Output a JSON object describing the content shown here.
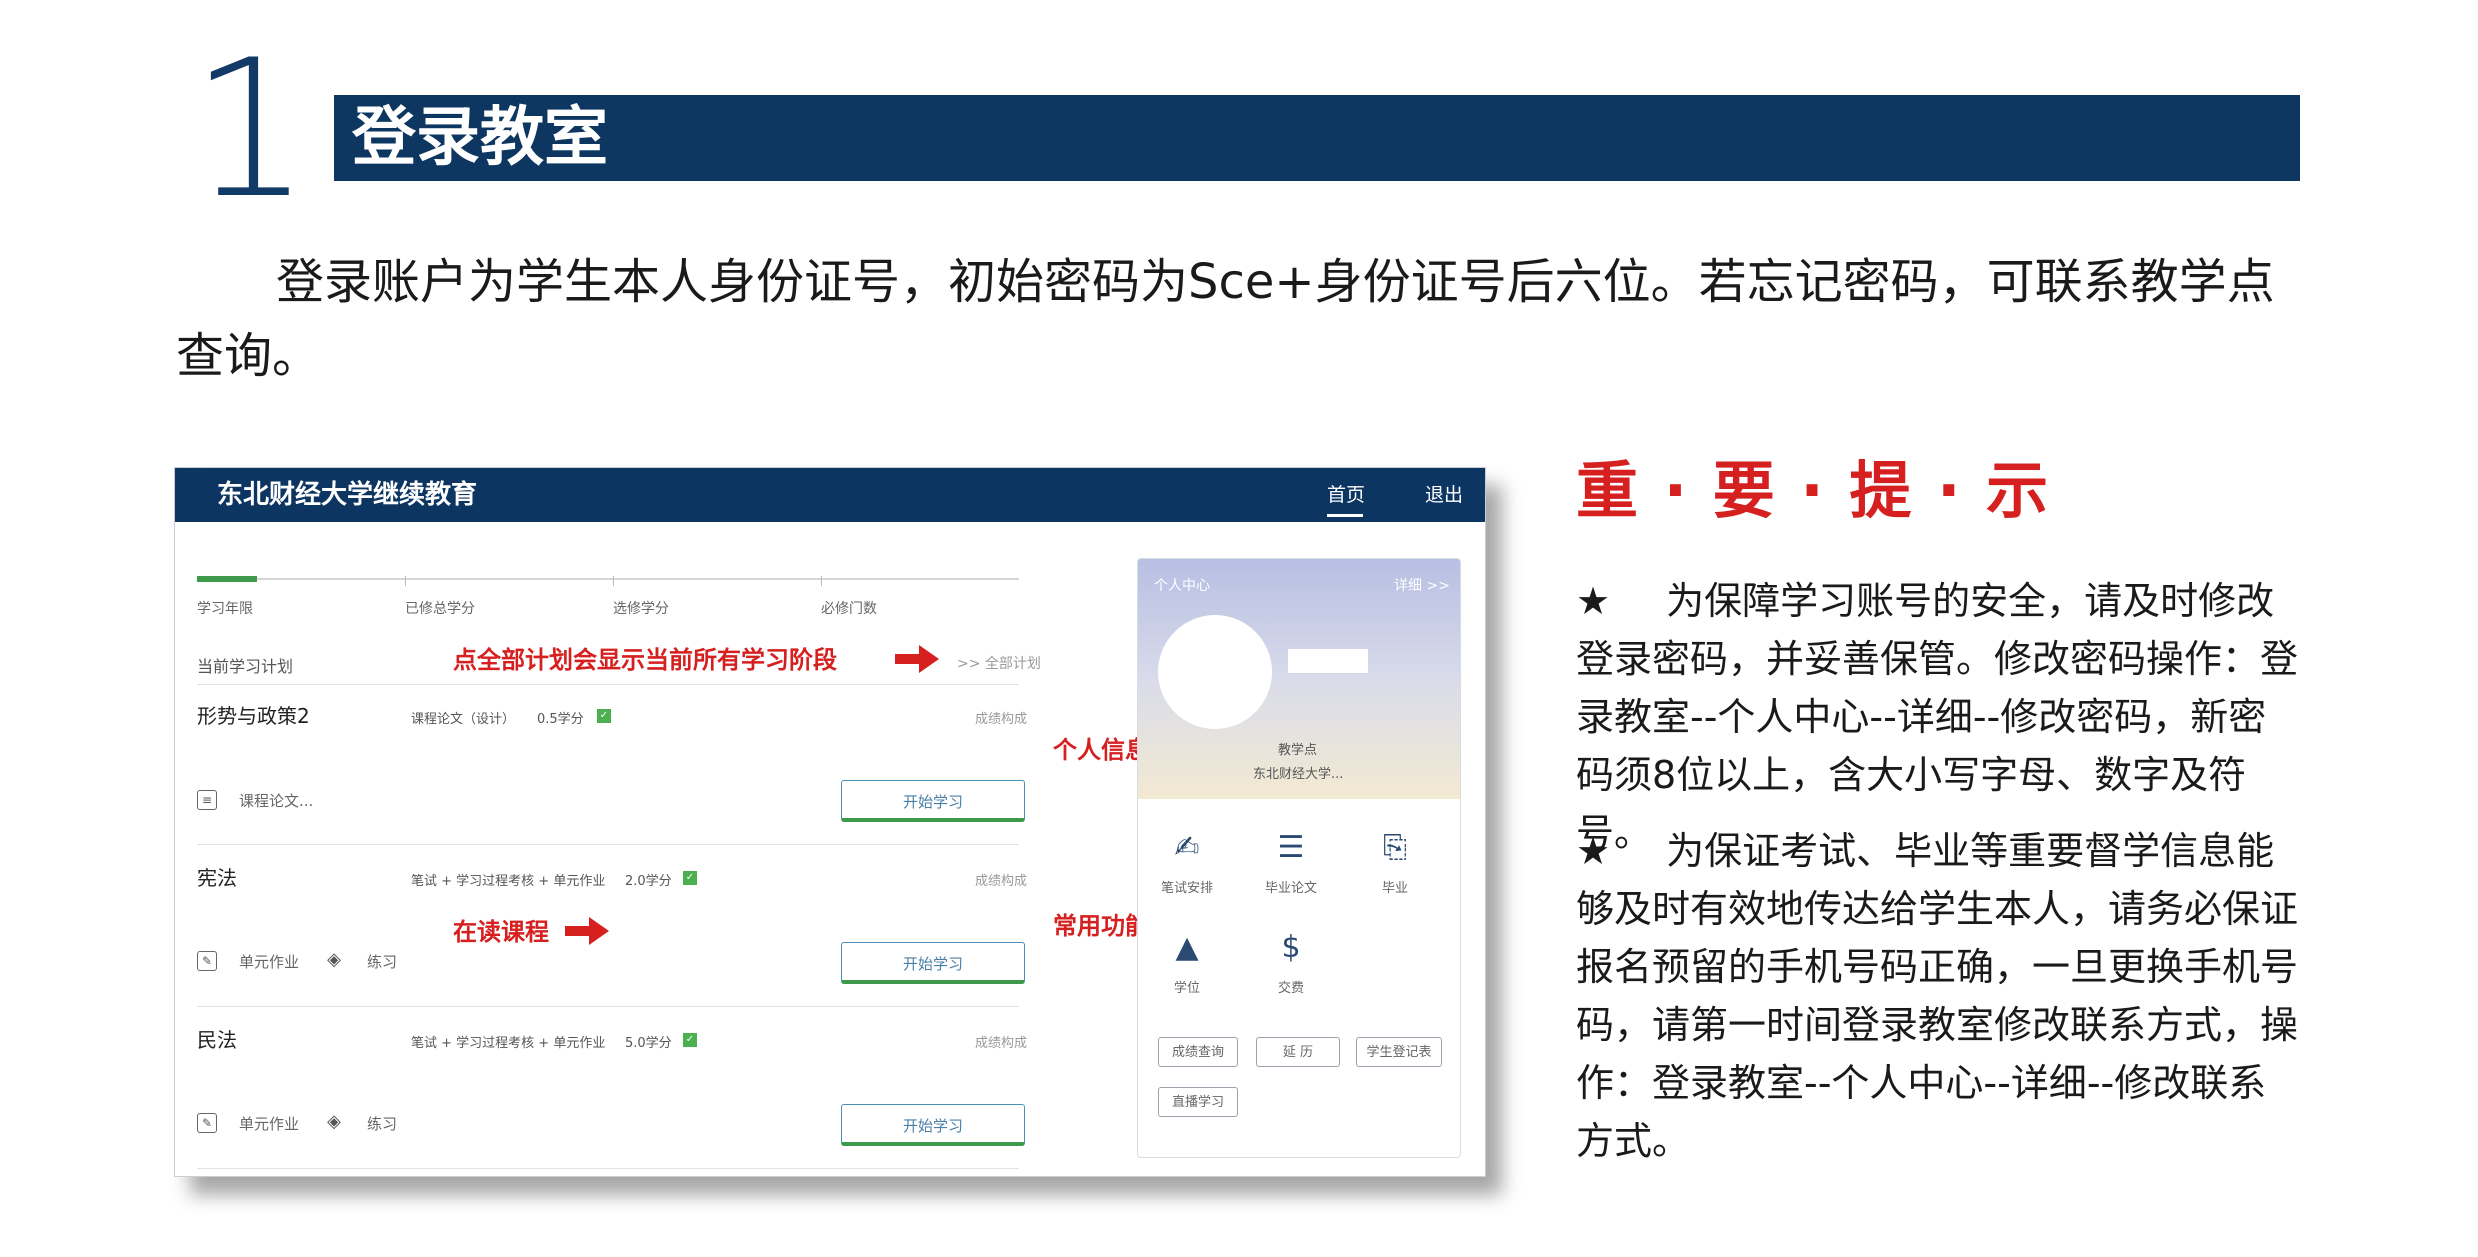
{
  "section": {
    "number": "1",
    "title": "登录教室"
  },
  "intro": "登录账户为学生本人身份证号，初始密码为Sce+身份证号后六位。若忘记密码，可联系教学点查询。",
  "screenshot": {
    "brand": "东北财经大学继续教育",
    "nav_home": "首页",
    "nav_exit": "退出",
    "stats": [
      "学习年限",
      "已修总学分",
      "选修学分",
      "必修门数"
    ],
    "plan_label": "当前学习计划",
    "all_plan_link": ">> 全部计划",
    "annotation_all_plan": "点全部计划会显示当前所有学习阶段",
    "annotation_personal": "个人信息",
    "annotation_courses": "在读课程",
    "annotation_functions": "常用功能",
    "courses": [
      {
        "name": "形势与政策2",
        "meta": "课程论文（设计）",
        "credit": "0.5学分",
        "score": "成绩构成",
        "subs": [
          {
            "icon": "document-icon",
            "glyph": "≡",
            "label": "课程论文..."
          }
        ],
        "button": "开始学习"
      },
      {
        "name": "宪法",
        "meta": "笔试 + 学习过程考核 + 单元作业",
        "credit": "2.0学分",
        "score": "成绩构成",
        "subs": [
          {
            "icon": "edit-icon",
            "glyph": "✎",
            "label": "单元作业"
          },
          {
            "icon": "layers-icon",
            "glyph": "◈",
            "label": "练习"
          }
        ],
        "button": "开始学习"
      },
      {
        "name": "民法",
        "meta": "笔试 + 学习过程考核 + 单元作业",
        "credit": "5.0学分",
        "score": "成绩构成",
        "subs": [
          {
            "icon": "edit-icon",
            "glyph": "✎",
            "label": "单元作业"
          },
          {
            "icon": "layers-icon",
            "glyph": "◈",
            "label": "练习"
          }
        ],
        "button": "开始学习"
      }
    ],
    "personal_center": {
      "title": "个人中心",
      "detail": "详细 >>",
      "point_label": "教学点",
      "university": "东北财经大学...",
      "functions": [
        {
          "icon": "exam-schedule-icon",
          "glyph": "✍",
          "label": "笔试安排"
        },
        {
          "icon": "thesis-icon",
          "glyph": "☰",
          "label": "毕业论文"
        },
        {
          "icon": "graduation-cert-icon",
          "glyph": "⎘",
          "label": "毕业"
        },
        {
          "icon": "degree-cap-icon",
          "glyph": "🎓",
          "label": "学位"
        },
        {
          "icon": "payment-icon",
          "glyph": "$",
          "label": "交费"
        }
      ],
      "buttons": [
        "成绩查询",
        "延 历",
        "学生登记表",
        "直播学习"
      ]
    }
  },
  "tips": {
    "title": "重 · 要 · 提 · 示",
    "star": "★",
    "items": [
      "为保障学习账号的安全，请及时修改登录密码，并妥善保管。修改密码操作：登录教室--个人中心--详细--修改密码，新密码须8位以上，含大小写字母、数字及符号。",
      "为保证考试、毕业等重要督学信息能够及时有效地传达给学生本人，请务必保证报名预留的手机号码正确，一旦更换手机号码，请第一时间登录教室修改联系方式，操作：登录教室--个人中心--详细--修改联系方式。"
    ]
  },
  "colors": {
    "header_navy": "#0d3761",
    "alert_red": "#d61f1f",
    "progress_green": "#3c9a4a"
  }
}
